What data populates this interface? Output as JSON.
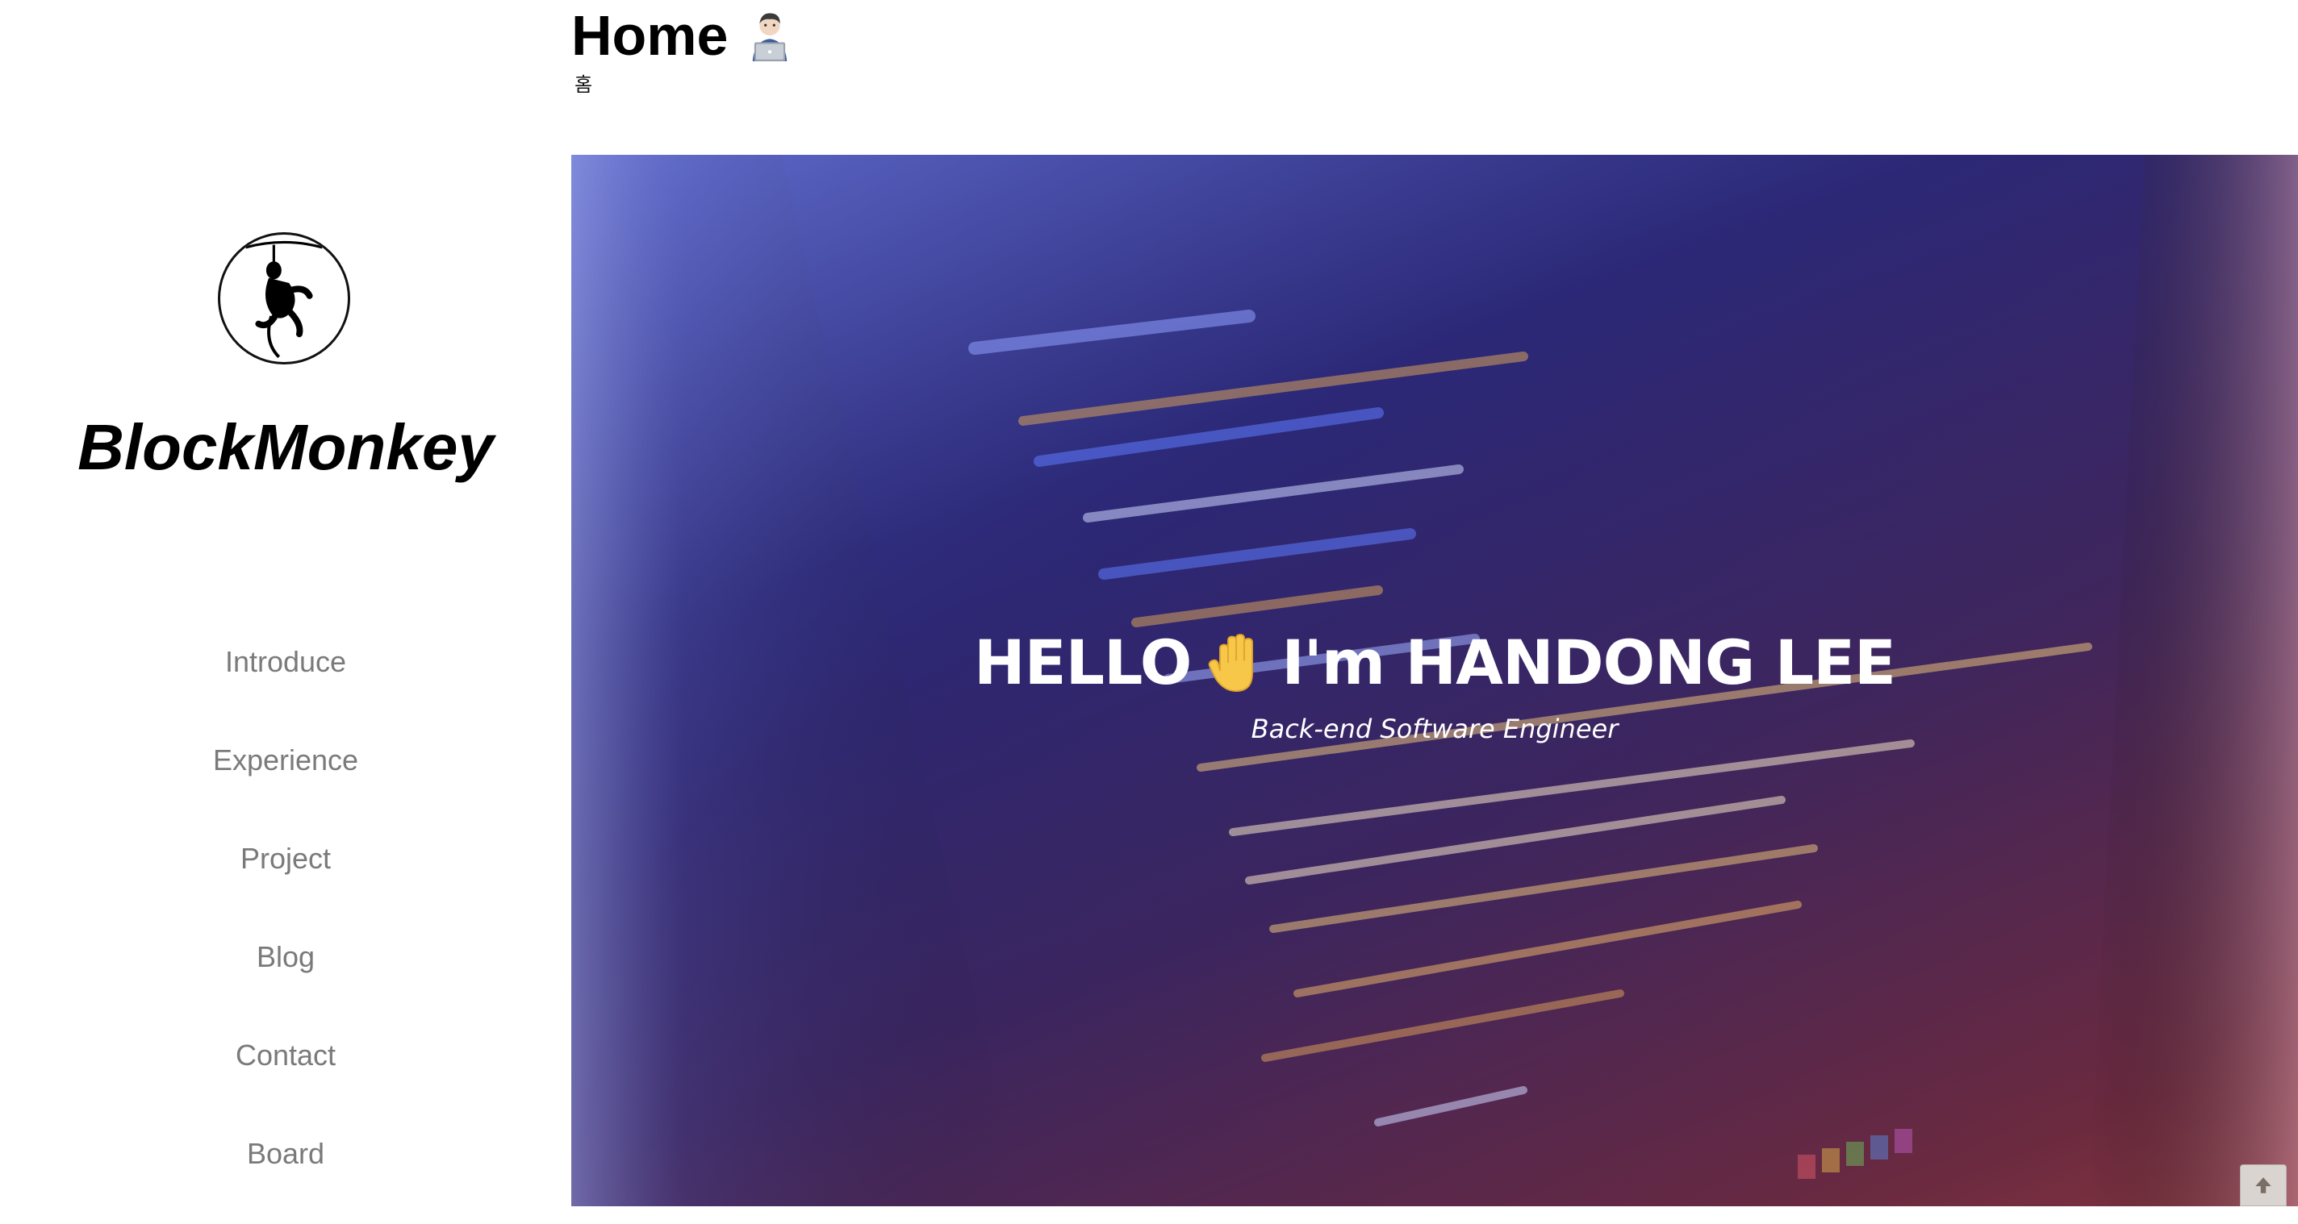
{
  "sidebar": {
    "brand": "BlockMonkey",
    "logo_icon": "monkey-silhouette-icon",
    "nav": [
      {
        "label": "Introduce"
      },
      {
        "label": "Experience"
      },
      {
        "label": "Project"
      },
      {
        "label": "Blog"
      },
      {
        "label": "Contact"
      },
      {
        "label": "Board"
      }
    ]
  },
  "header": {
    "title": "Home",
    "title_icon": "technologist-emoji-icon",
    "subtitle": "홈"
  },
  "hero": {
    "heading_left": "HELLO",
    "heading_icon": "raised-hand-emoji-icon",
    "heading_right": "I'm HANDONG LEE",
    "subheading": "Back-end Software Engineer",
    "background": "code-screen-photo"
  },
  "scroll_top": {
    "icon": "arrow-up-icon"
  },
  "colors": {
    "nav_text": "#7a7a7a",
    "hero_text": "#ffffff",
    "hero_overlay_top": "#2d2a7a",
    "hero_overlay_bottom": "#6a2a3e"
  }
}
